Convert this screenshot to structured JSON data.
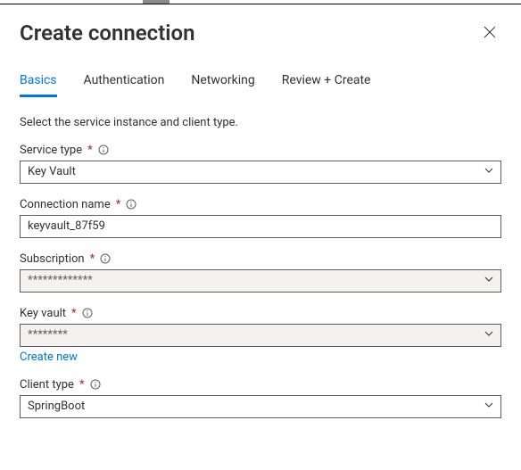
{
  "header": {
    "title": "Create connection"
  },
  "tabs": {
    "basics": "Basics",
    "authentication": "Authentication",
    "networking": "Networking",
    "review": "Review + Create",
    "active": "basics"
  },
  "intro": "Select the service instance and client type.",
  "fields": {
    "service_type": {
      "label": "Service type",
      "value": "Key Vault"
    },
    "connection_name": {
      "label": "Connection name",
      "value": "keyvault_87f59"
    },
    "subscription": {
      "label": "Subscription",
      "value": "*************"
    },
    "key_vault": {
      "label": "Key vault",
      "value": "********",
      "create_new": "Create new"
    },
    "client_type": {
      "label": "Client type",
      "value": "SpringBoot"
    }
  },
  "glyphs": {
    "required": "*"
  }
}
